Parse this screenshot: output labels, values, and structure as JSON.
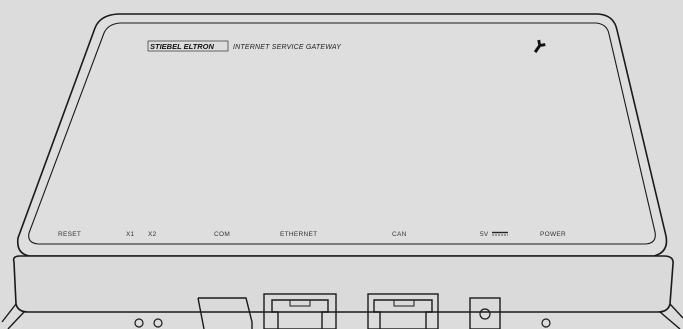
{
  "device": {
    "brand": "STIEBEL ELTRON",
    "subtitle": "INTERNET SERVICE GATEWAY",
    "logo_icon": "wrench-icon"
  },
  "port_labels": [
    {
      "id": "reset",
      "text": "RESET"
    },
    {
      "id": "x1",
      "text": "X1"
    },
    {
      "id": "x2",
      "text": "X2"
    },
    {
      "id": "com",
      "text": "COM"
    },
    {
      "id": "ethernet",
      "text": "ETHERNET"
    },
    {
      "id": "can",
      "text": "CAN"
    },
    {
      "id": "5v",
      "text": "5V"
    },
    {
      "id": "power",
      "text": "POWER"
    }
  ],
  "colors": {
    "background": "#dcdcdc",
    "outline": "#1a1a1a",
    "body": "#dedede"
  }
}
